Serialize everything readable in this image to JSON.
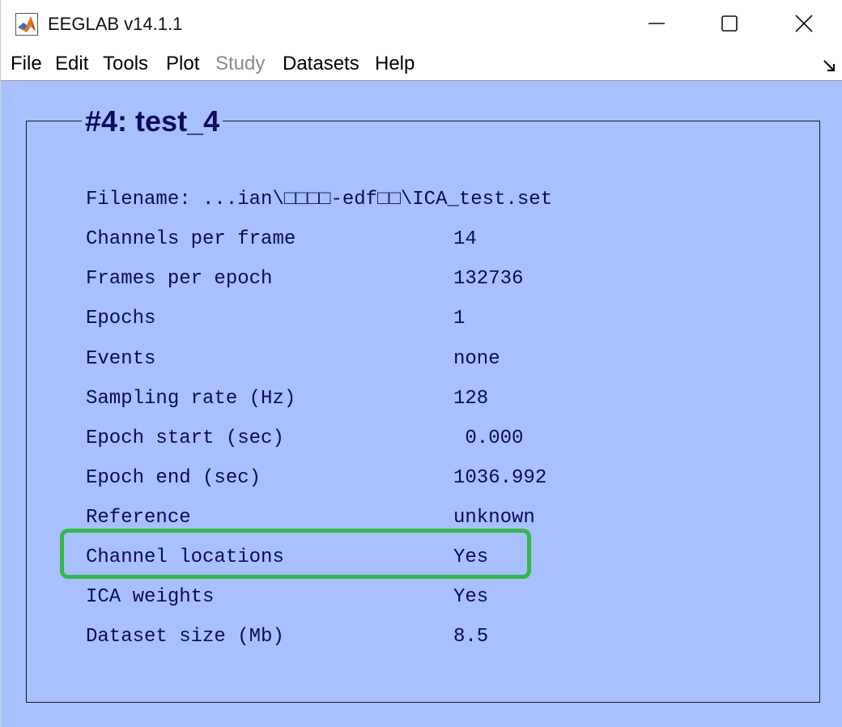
{
  "window": {
    "title": "EEGLAB v14.1.1",
    "icon": "matlab-icon",
    "controls": {
      "minimize": "minimize-icon",
      "maximize": "maximize-icon",
      "close": "close-icon"
    }
  },
  "menubar": {
    "items": [
      {
        "label": "File",
        "enabled": true
      },
      {
        "label": "Edit",
        "enabled": true
      },
      {
        "label": "Tools",
        "enabled": true
      },
      {
        "label": "Plot",
        "enabled": true
      },
      {
        "label": "Study",
        "enabled": false
      },
      {
        "label": "Datasets",
        "enabled": true
      },
      {
        "label": "Help",
        "enabled": true
      }
    ],
    "corner_icon": "undock-arrow-icon"
  },
  "dataset": {
    "title": "#4: test_4",
    "filename_row": "Filename: ...ian\\□□□□-edf□□\\ICA_test.set",
    "rows": [
      {
        "label": "Channels per frame",
        "value": "14"
      },
      {
        "label": "Frames per epoch",
        "value": "132736"
      },
      {
        "label": "Epochs",
        "value": "1"
      },
      {
        "label": "Events",
        "value": "none"
      },
      {
        "label": "Sampling rate (Hz)",
        "value": "128"
      },
      {
        "label": "Epoch start (sec)",
        "value": " 0.000"
      },
      {
        "label": "Epoch end (sec)",
        "value": "1036.992"
      },
      {
        "label": "Reference",
        "value": "unknown"
      },
      {
        "label": "Channel locations",
        "value": "Yes",
        "highlighted": true
      },
      {
        "label": "ICA weights",
        "value": "Yes"
      },
      {
        "label": "Dataset size (Mb)",
        "value": "8.5"
      }
    ]
  },
  "colors": {
    "background": "#a8c0fd",
    "text": "#0a0a5e",
    "highlight": "#35b84a"
  }
}
